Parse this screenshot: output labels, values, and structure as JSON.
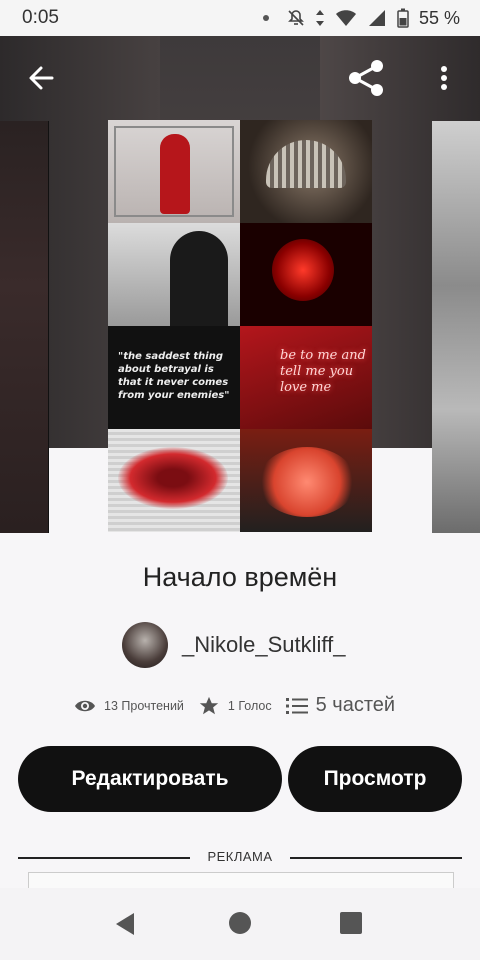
{
  "status_bar": {
    "time": "0:05",
    "battery": "55 %",
    "icons": [
      "dot-icon",
      "mute-icon",
      "data-icon",
      "wifi-icon",
      "signal-icon",
      "battery-icon"
    ]
  },
  "app_bar": {
    "back_icon": "arrow-left-icon",
    "share_icon": "share-icon",
    "more_icon": "more-vertical-icon"
  },
  "cover": {
    "quote": "\"the saddest thing about betrayal is that it never comes from your enemies\"",
    "neon": "be to me and tell me you love me"
  },
  "story": {
    "title": "Начало времён",
    "author": "_Nikole_Sutkliff_",
    "reads": "13 Прочтений",
    "votes": "1 Голос",
    "parts": "5 частей"
  },
  "actions": {
    "edit": "Редактировать",
    "view": "Просмотр"
  },
  "ad": {
    "label": "РЕКЛАМА"
  },
  "nav": {
    "icons": [
      "back-triangle-icon",
      "home-circle-icon",
      "recents-square-icon"
    ]
  }
}
